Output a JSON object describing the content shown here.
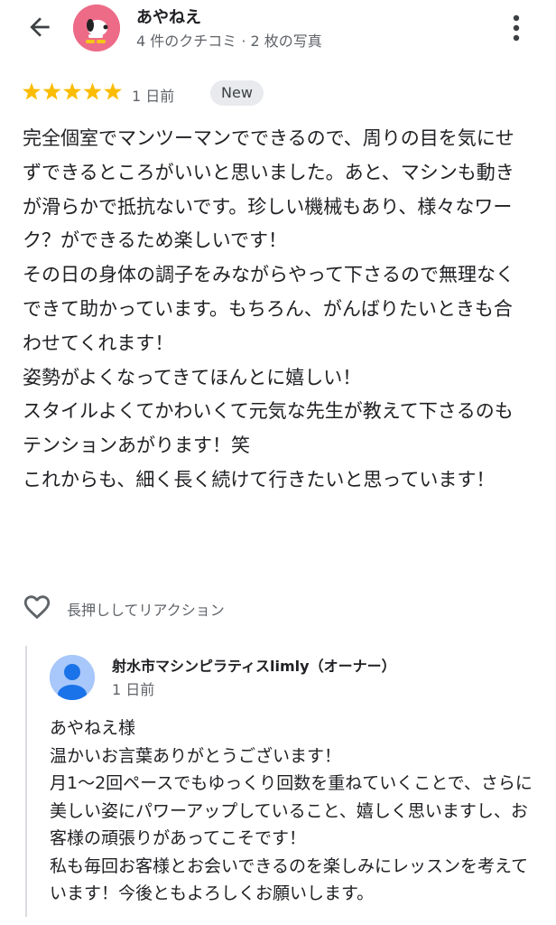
{
  "header": {
    "back_icon": "arrow-back-icon",
    "reviewer_name": "あやねえ",
    "reviewer_meta": "4 件のクチコミ · 2 枚の写真",
    "avatar_icon": "snoopy-avatar",
    "avatar_color": "#ee6b88",
    "more_icon": "more-vert-icon"
  },
  "review": {
    "rating": 5,
    "max_rating": 5,
    "star_color": "#fbbc04",
    "date": "1 日前",
    "badge": "New",
    "text": "完全個室でマンツーマンでできるので、周りの目を気にせずできるところがいいと思いました。あと、マシンも動きが滑らかで抵抗ないです。珍しい機械もあり、様々なワーク？ができるため楽しいです！\nその日の身体の調子をみながらやって下さるので無理なくできて助かっています。もちろん、がんばりたいときも合わせてくれます！\n姿勢がよくなってきてほんとに嬉しい！\nスタイルよくてかわいくて元気な先生が教えて下さるのもテンションあがります！笑\nこれからも、細く長く続けて行きたいと思っています！"
  },
  "reaction": {
    "heart_icon": "heart-outline-icon",
    "label": "長押ししてリアクション"
  },
  "owner_reply": {
    "avatar_icon": "person-avatar",
    "avatar_color": "#a8c7fa",
    "name": "射水市マシンピラティスlimly（オーナー）",
    "date": "1 日前",
    "text": "あやねえ様\n温かいお言葉ありがとうございます！\n月1〜2回ペースでもゆっくり回数を重ねていくことで、さらに美しい姿にパワーアップしていること、嬉しく思いますし、お客様の頑張りがあってこそです！\n私も毎回お客様とお会いできるのを楽しみにレッスンを考えています！今後ともよろしくお願いします。"
  }
}
